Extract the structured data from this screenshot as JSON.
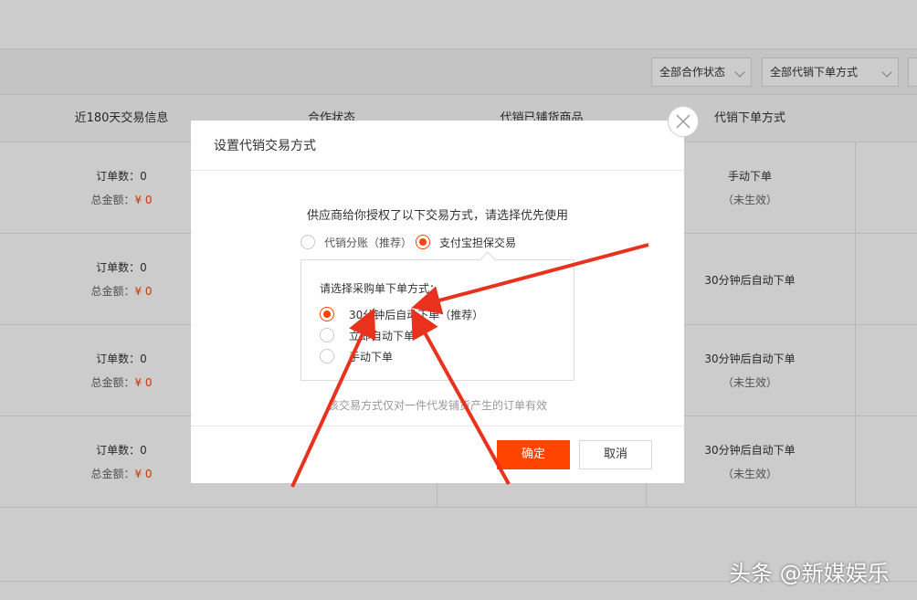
{
  "filters": {
    "cooperation_status": "全部合作状态",
    "order_mode": "全部代销下单方式"
  },
  "table": {
    "headers": [
      "近180天交易信息",
      "合作状态",
      "代销已铺货商品",
      "代销下单方式"
    ],
    "rows": [
      {
        "orders": "订单数：0",
        "amount_label": "总金额：",
        "amount_value": "¥ 0",
        "mode": "手动下单",
        "mode_note": "（未生效）"
      },
      {
        "orders": "订单数：0",
        "amount_label": "总金额：",
        "amount_value": "¥ 0",
        "mode": "30分钟后自动下单",
        "mode_note": ""
      },
      {
        "orders": "订单数：0",
        "amount_label": "总金额：",
        "amount_value": "¥ 0",
        "mode": "30分钟后自动下单",
        "mode_note": "（未生效）"
      },
      {
        "orders": "订单数：0",
        "amount_label": "总金额：",
        "amount_value": "¥ 0",
        "mode": "30分钟后自动下单",
        "mode_note": "（未生效）"
      }
    ]
  },
  "dialog": {
    "title": "设置代销交易方式",
    "description": "供应商给你授权了以下交易方式，请选择优先使用",
    "trade_options": [
      {
        "label": "代销分账（推荐）",
        "selected": false
      },
      {
        "label": "支付宝担保交易",
        "selected": true
      }
    ],
    "sub_title": "请选择采购单下单方式：",
    "order_options": [
      {
        "label": "30分钟后自动下单（推荐）",
        "selected": true
      },
      {
        "label": "立即自动下单",
        "selected": false
      },
      {
        "label": "手动下单",
        "selected": false
      }
    ],
    "note": "该交易方式仅对一件代发铺货产生的订单有效",
    "confirm_label": "确定",
    "cancel_label": "取消"
  },
  "icons": {
    "close": "close-icon",
    "dropdown": "chevron-down-icon"
  },
  "colors": {
    "accent": "#ff4400",
    "annotation_arrow": "#e8321e"
  },
  "watermark": "头条 @新媒娱乐"
}
